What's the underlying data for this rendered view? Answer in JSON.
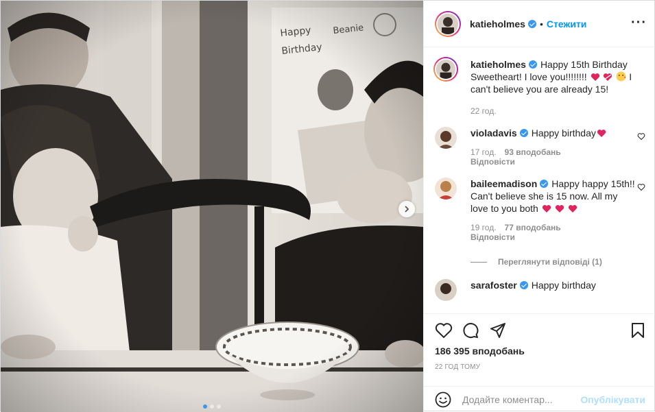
{
  "post": {
    "author": "katieholmes",
    "follow_label": "Стежити",
    "separator": "•",
    "more_label": "···"
  },
  "photo": {
    "drawing_text": "Happy Birthday Beanie",
    "carousel_dots": 3,
    "active_dot": 0
  },
  "caption": {
    "username": "katieholmes",
    "text_part1": "Happy 15th Birthday Sweetheart! I love you!!!!!!!!",
    "text_part2": "I can't believe you are already 15!",
    "time": "22 год."
  },
  "comments": [
    {
      "username": "violadavis",
      "text": "Happy birthday",
      "time": "17 год.",
      "likes": "93 вподобань",
      "reply_label": "Відповісти"
    },
    {
      "username": "baileemadison",
      "text": "Happy happy 15th!! Can't believe she is 15 now. All my love to you both",
      "time": "19 год.",
      "likes": "77 вподобань",
      "reply_label": "Відповісти",
      "view_replies": "Переглянути відповіді (1)"
    }
  ],
  "partial_comment": {
    "username": "sarafoster",
    "text": "Happy birthday"
  },
  "actions": {
    "likes_count": "186 395 вподобань",
    "time_ago": "22 год тому"
  },
  "add_comment": {
    "placeholder": "Додайте коментар...",
    "publish_label": "Опублікувати"
  },
  "colors": {
    "accent": "#0095f6",
    "verified": "#3897f0",
    "heart": "#ed4956",
    "muted": "#8e8e8e",
    "publish_disabled": "#b2dffc"
  }
}
